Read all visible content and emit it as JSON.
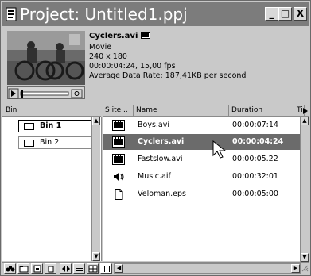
{
  "window": {
    "title": "Project: Untitled1.ppj",
    "controls": {
      "minimize": "_",
      "maximize": "□",
      "close": "X"
    }
  },
  "preview": {
    "clip_name": "Cyclers.avi",
    "lines": [
      "Movie",
      "240 x 180",
      "00:00:04:24, 15,00 fps",
      "Average Data Rate: 187,41KB per second"
    ]
  },
  "bins_pane": {
    "header": "Bin",
    "items": [
      {
        "label": "Bin 1",
        "selected": true
      },
      {
        "label": "Bin 2",
        "selected": false
      }
    ]
  },
  "clips_pane": {
    "columns": {
      "status": "S ite...",
      "name": "Name",
      "duration": "Duration",
      "extra": "Ti"
    },
    "rows": [
      {
        "icon": "film-icon",
        "name": "Boys.avi",
        "duration": "00:00:07:14",
        "selected": false
      },
      {
        "icon": "film-icon",
        "name": "Cyclers.avi",
        "duration": "00:00:04:24",
        "selected": true
      },
      {
        "icon": "film-icon",
        "name": "Fastslow.avi",
        "duration": "00:00:05.22",
        "selected": false
      },
      {
        "icon": "speaker-icon",
        "name": "Music.aif",
        "duration": "00:00:32:01",
        "selected": false
      },
      {
        "icon": "document-icon",
        "name": "Veloman.eps",
        "duration": "00:00:05:00",
        "selected": false
      }
    ]
  },
  "toolbar": {
    "buttons": [
      "find-icon",
      "new-bin-icon",
      "new-item-icon",
      "trash-icon",
      "timecode-icon",
      "list-view-icon",
      "thumbnail-view-icon",
      "text-view-icon"
    ]
  },
  "colors": {
    "selection": "#6b6b6b",
    "titlebar": "#7c7c7c",
    "chrome": "#c9c9c9"
  }
}
